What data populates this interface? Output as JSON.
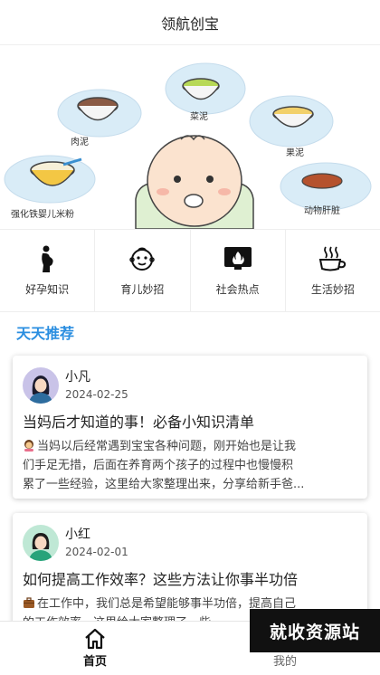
{
  "header": {
    "title": "领航创宝"
  },
  "banner": {
    "labels": {
      "meat": "肉泥",
      "veg": "菜泥",
      "fruit": "果泥",
      "rice": "强化铁婴儿米粉",
      "liver": "动物肝脏"
    }
  },
  "categories": [
    {
      "label": "好孕知识",
      "icon": "pregnant-icon"
    },
    {
      "label": "育儿妙招",
      "icon": "baby-face-icon"
    },
    {
      "label": "社会热点",
      "icon": "fire-screen-icon"
    },
    {
      "label": "生活妙招",
      "icon": "coffee-cup-icon"
    }
  ],
  "section": {
    "title": "天天推荐"
  },
  "posts": [
    {
      "author": "小凡",
      "date": "2024-02-25",
      "title": "当妈后才知道的事！必备小知识清单",
      "excerpt_line1": "当妈以后经常遇到宝宝各种问题，刚开始也是让我",
      "excerpt_line2": "们手足无措，后面在养育两个孩子的过程中也慢慢积",
      "excerpt_line3": "累了一些经验，这里给大家整理出来，分享给新手爸..."
    },
    {
      "author": "小红",
      "date": "2024-02-01",
      "title": "如何提高工作效率？这些方法让你事半功倍",
      "excerpt_line1": "在工作中，我们总是希望能够事半功倍，提高自己",
      "excerpt_line2": "的工作效率。这里给大家整理了一些"
    }
  ],
  "tabbar": {
    "home": "首页",
    "mine": "我的"
  },
  "watermark": "就收资源站",
  "colors": {
    "accent": "#2a8ee0"
  }
}
